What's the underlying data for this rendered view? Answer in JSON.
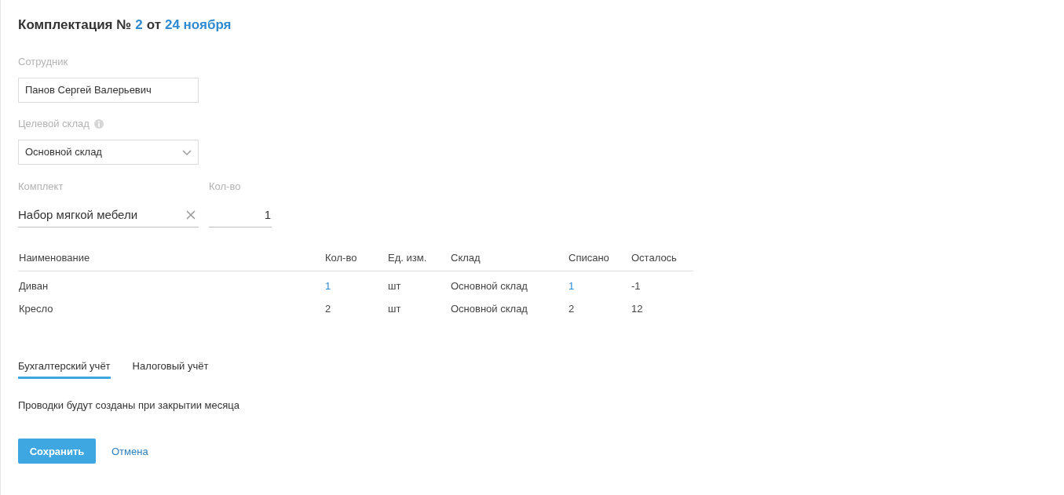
{
  "title": {
    "prefix": "Комплектация №",
    "number": "2",
    "separator": "от",
    "date": "24 ноября"
  },
  "employee": {
    "label": "Сотрудник",
    "value": "Панов Сергей Валерьевич"
  },
  "warehouse": {
    "label": "Целевой склад",
    "value": "Основной склад"
  },
  "kit": {
    "label": "Комплект",
    "value": "Набор мягкой мебели"
  },
  "quantity": {
    "label": "Кол-во",
    "value": "1"
  },
  "table": {
    "columns": [
      "Наименование",
      "Кол-во",
      "Ед. изм.",
      "Склад",
      "Списано",
      "Осталось"
    ],
    "rows": [
      {
        "name": "Диван",
        "qty": {
          "text": "1",
          "highlighted": true
        },
        "unit": "шт",
        "warehouse": "Основной склад",
        "written_off": {
          "text": "1",
          "highlighted": true
        },
        "remaining": "-1"
      },
      {
        "name": "Кресло",
        "qty": {
          "text": "2",
          "highlighted": false
        },
        "unit": "шт",
        "warehouse": "Основной склад",
        "written_off": {
          "text": "2",
          "highlighted": false
        },
        "remaining": "12"
      }
    ]
  },
  "tabs": [
    {
      "label": "Бухгалтерский учёт",
      "selected": true
    },
    {
      "label": "Налоговый учёт",
      "selected": false
    }
  ],
  "note": "Проводки будут созданы при закрытии месяца",
  "buttons": {
    "save": "Сохранить",
    "cancel": "Отмена"
  }
}
